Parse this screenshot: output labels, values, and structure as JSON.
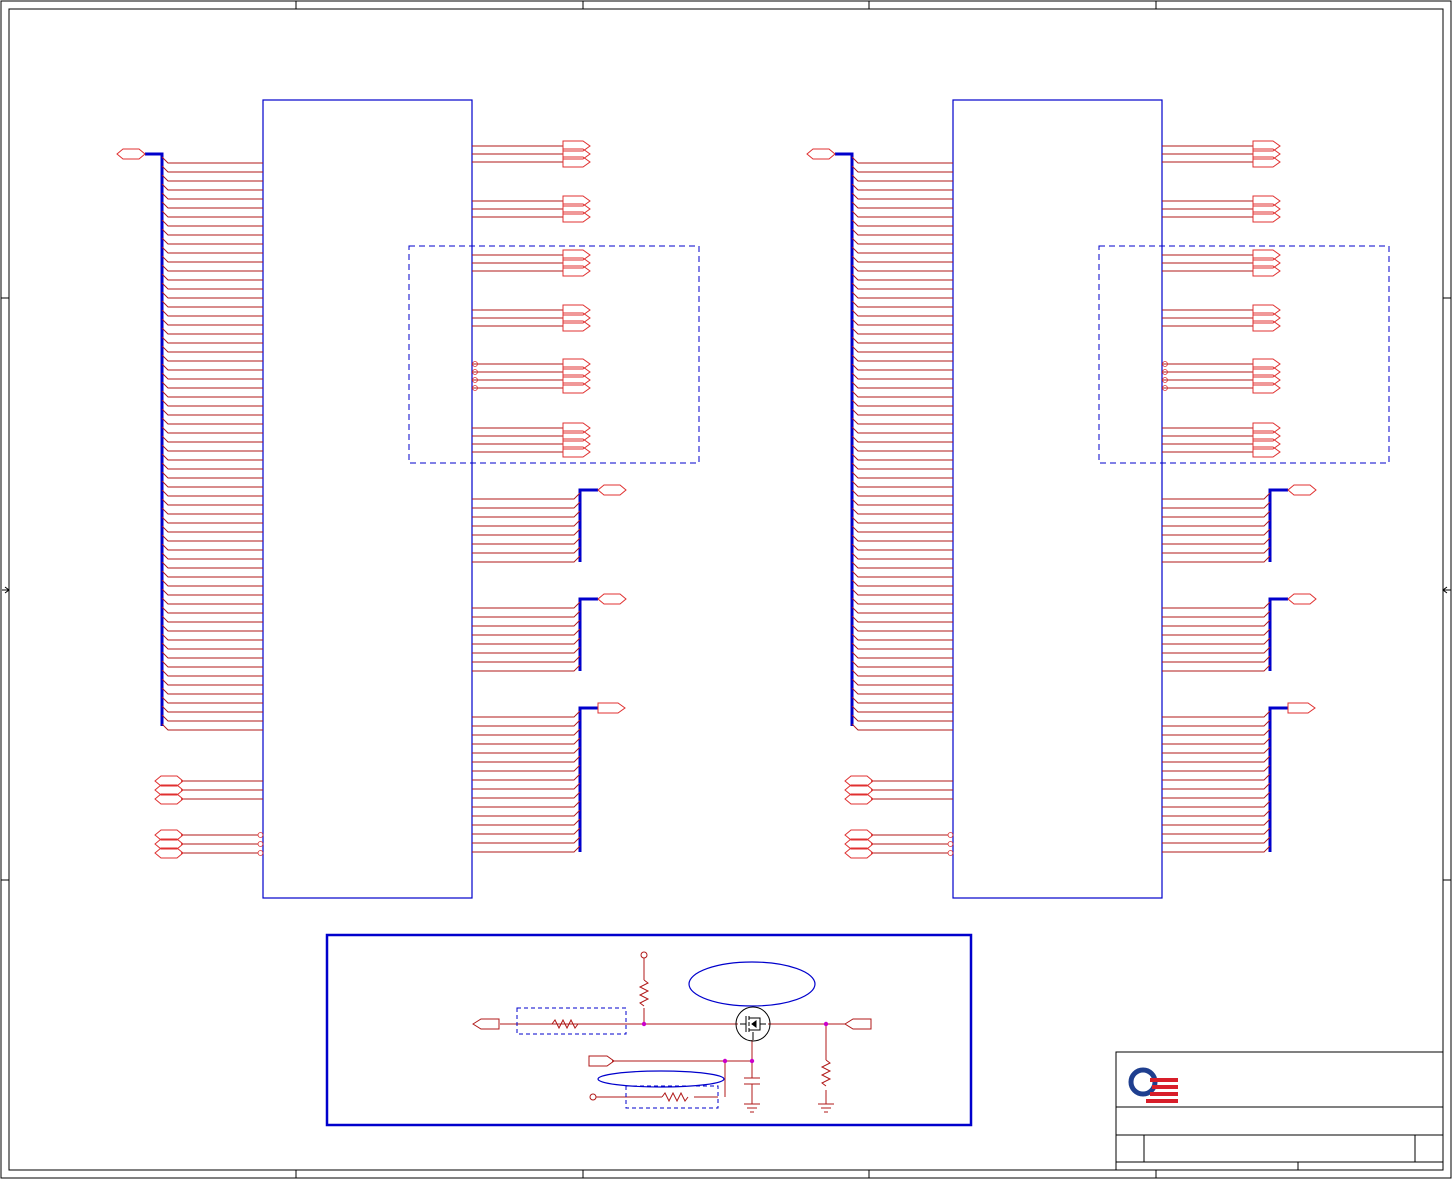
{
  "sheet": {
    "title": "",
    "colors": {
      "frame": "#000000",
      "wire": "#e03030",
      "wire_dark": "#b01818",
      "bus": "#0000cc",
      "box": "#0000cc",
      "junction": "#cc00cc",
      "logo_blue": "#1f3f8f",
      "logo_red": "#d81e2a"
    }
  },
  "ic_blocks": [
    {
      "name": "ic-left",
      "label": "",
      "input_bus_pins": 64,
      "output_groups": 11
    },
    {
      "name": "ic-right",
      "label": "",
      "input_bus_pins": 64,
      "output_groups": 11
    }
  ],
  "power_circuit": {
    "label": ""
  },
  "title_block": {
    "company": "",
    "drawing_title": "",
    "revision": ""
  },
  "logo": {
    "icon": "quanta-logo-icon"
  }
}
